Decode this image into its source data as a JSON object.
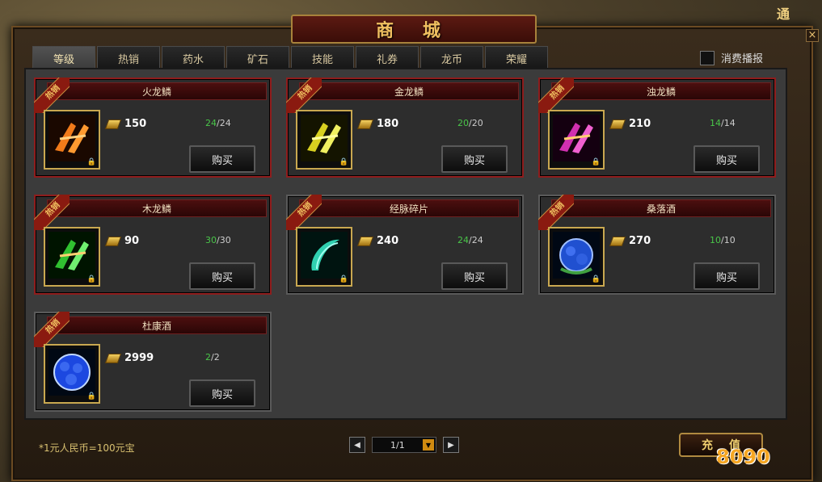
{
  "title": "商 城",
  "corner_text": "通",
  "close_label": "×",
  "tabs": [
    {
      "label": "等级",
      "active": true
    },
    {
      "label": "热销",
      "active": false
    },
    {
      "label": "药水",
      "active": false
    },
    {
      "label": "矿石",
      "active": false
    },
    {
      "label": "技能",
      "active": false
    },
    {
      "label": "礼券",
      "active": false
    },
    {
      "label": "龙币",
      "active": false
    },
    {
      "label": "荣耀",
      "active": false
    }
  ],
  "toggle_label": "消费播报",
  "hot_label": "热销",
  "buy_label": "购买",
  "lock_icon": "🔒",
  "items": [
    {
      "name": "火龙鳞",
      "price": "150",
      "stock_current": "24",
      "stock_total": "/24",
      "hot": true,
      "color": "#e85a1a"
    },
    {
      "name": "金龙鳞",
      "price": "180",
      "stock_current": "20",
      "stock_total": "/20",
      "hot": true,
      "color": "#e8e020"
    },
    {
      "name": "浊龙鳞",
      "price": "210",
      "stock_current": "14",
      "stock_total": "/14",
      "hot": true,
      "color": "#e040c0"
    },
    {
      "name": "木龙鳞",
      "price": "90",
      "stock_current": "30",
      "stock_total": "/30",
      "hot": true,
      "color": "#40d040"
    },
    {
      "name": "经脉碎片",
      "price": "240",
      "stock_current": "24",
      "stock_total": "/24",
      "hot": false,
      "color": "#30d0b0"
    },
    {
      "name": "桑落酒",
      "price": "270",
      "stock_current": "10",
      "stock_total": "/10",
      "hot": false,
      "color": "#3060e0"
    },
    {
      "name": "杜康酒",
      "price": "2999",
      "stock_current": "2",
      "stock_total": "/2",
      "hot": false,
      "color": "#2050e8"
    }
  ],
  "footer": {
    "rate_text": "*1元人民币=100元宝",
    "page_text": "1/1",
    "prev_label": "◀",
    "next_label": "▶",
    "drop_label": "▼",
    "recharge_label": "充值",
    "watermark": "8090"
  }
}
